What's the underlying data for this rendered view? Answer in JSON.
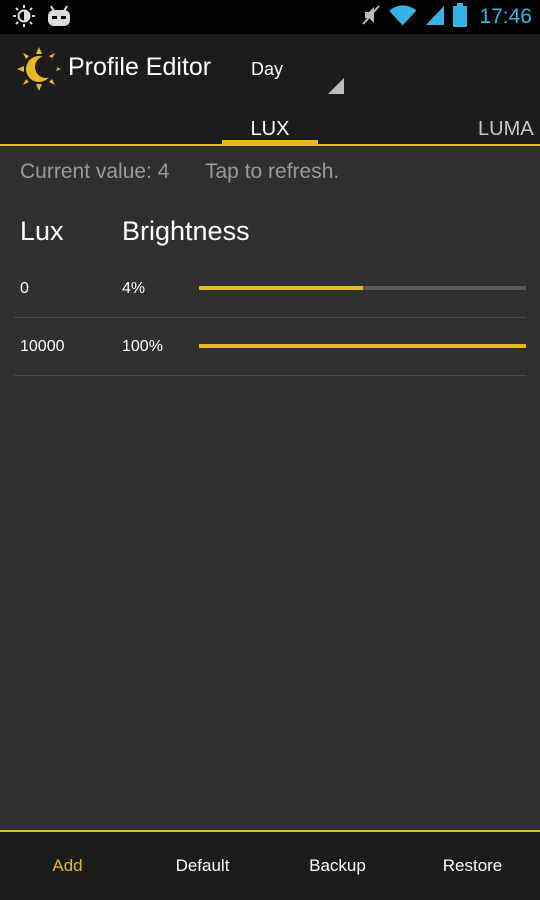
{
  "status_bar": {
    "time": "17:46",
    "icons": [
      "brightness-icon",
      "android-robot-icon",
      "no-sound-icon",
      "wifi-icon",
      "signal-icon",
      "battery-icon"
    ]
  },
  "action_bar": {
    "title": "Profile Editor",
    "profile": "Day",
    "app_icon": "sun-moon-icon"
  },
  "tabs": [
    {
      "label": "LUX",
      "selected": true
    },
    {
      "label": "LUMA",
      "selected": false
    }
  ],
  "info": {
    "current_value": "Current value: 4",
    "refresh_hint": "Tap to refresh."
  },
  "table": {
    "headers": {
      "lux": "Lux",
      "brightness": "Brightness"
    },
    "rows": [
      {
        "lux": "0",
        "brightness": "4%",
        "level": 0.5
      },
      {
        "lux": "10000",
        "brightness": "100%",
        "level": 1.0
      }
    ]
  },
  "bottom_bar": {
    "add": "Add",
    "default": "Default",
    "backup": "Backup",
    "restore": "Restore"
  },
  "colors": {
    "accent": "#e8b920",
    "clock": "#33b5e5",
    "background": "#303030",
    "bar": "#1c1c1c"
  }
}
